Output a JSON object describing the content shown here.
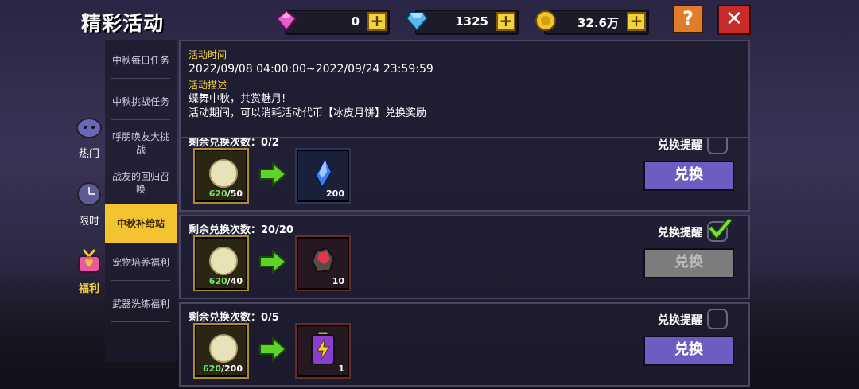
{
  "title": "精彩活动",
  "currency": {
    "gems": "0",
    "diamonds": "1325",
    "gold": "32.6万"
  },
  "help_label": "?",
  "close_label": "✕",
  "categories": [
    {
      "label": "热门",
      "icon": "hot-icon"
    },
    {
      "label": "限时",
      "icon": "timer-icon"
    },
    {
      "label": "福利",
      "icon": "gift-icon"
    }
  ],
  "subnav": [
    {
      "label": "中秋每日任务"
    },
    {
      "label": "中秋挑战任务"
    },
    {
      "label": "呼朋唤友大挑战"
    },
    {
      "label": "战友的回归召唤"
    },
    {
      "label": "中秋补给站",
      "active": true
    },
    {
      "label": "宠物培养福利"
    },
    {
      "label": "武器洗练福利"
    }
  ],
  "info": {
    "time_label": "活动时间",
    "time_value": "2022/09/08 04:00:00~2022/09/24 23:59:59",
    "desc_label": "活动描述",
    "desc_line1": "蝶舞中秋，共赏魅月!",
    "desc_line2": "活动期间，可以消耗活动代币【冰皮月饼】兑换奖励"
  },
  "rows": [
    {
      "count": "剩余兑换次数：0/2",
      "have": "620",
      "cost": "/50",
      "reward_qty": "200",
      "reward_icon": "crystal-icon",
      "remind": "兑换提醒",
      "checked": false,
      "button": "兑换",
      "disabled": false
    },
    {
      "count": "剩余兑换次数：20/20",
      "have": "620",
      "cost": "/40",
      "reward_qty": "10",
      "reward_icon": "red-ore-icon",
      "remind": "兑换提醒",
      "checked": true,
      "button": "兑换",
      "disabled": true
    },
    {
      "count": "剩余兑换次数：0/5",
      "have": "620",
      "cost": "/200",
      "reward_qty": "1",
      "reward_icon": "energy-battery-icon",
      "remind": "兑换提醒",
      "checked": false,
      "button": "兑换",
      "disabled": false
    }
  ]
}
